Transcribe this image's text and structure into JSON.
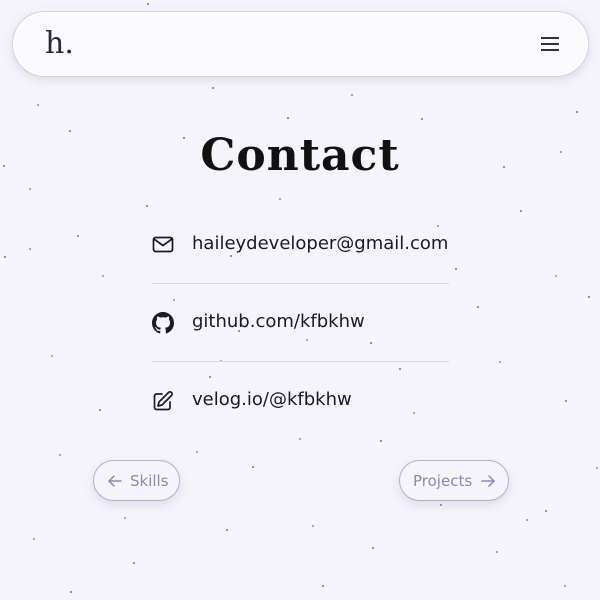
{
  "header": {
    "logo": "h.",
    "menu_icon": "hamburger-menu-icon"
  },
  "page_title": "Contact",
  "contacts": [
    {
      "icon": "mail-icon",
      "text": "haileydeveloper@gmail.com"
    },
    {
      "icon": "github-icon",
      "text": "github.com/kfbkhw"
    },
    {
      "icon": "edit-icon",
      "text": "velog.io/@kfbkhw"
    }
  ],
  "navigation": {
    "prev_label": "Skills",
    "prev_icon": "arrow-left-icon",
    "next_label": "Projects",
    "next_icon": "arrow-right-icon"
  },
  "colors": {
    "background": "#f5f4fa",
    "accent": "#8f88b1",
    "border": "#b4aed0"
  }
}
